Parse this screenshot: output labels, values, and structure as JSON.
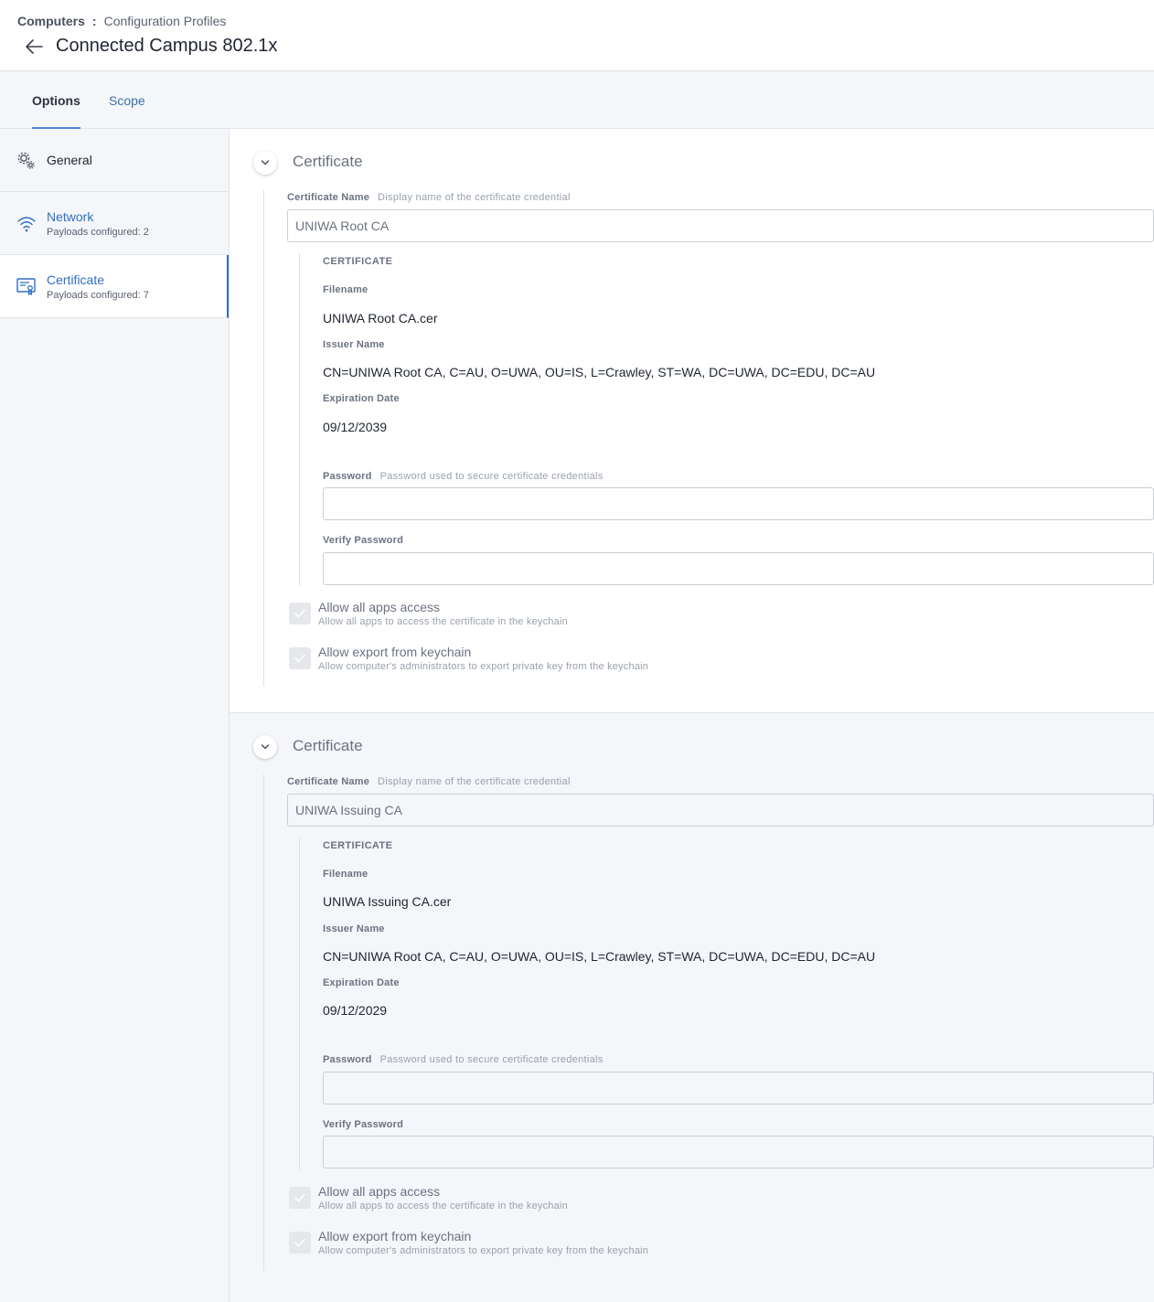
{
  "header": {
    "breadcrumb_root": "Computers",
    "breadcrumb_separator": ":",
    "breadcrumb_current": "Configuration Profiles",
    "title": "Connected Campus 802.1x"
  },
  "tabs": [
    {
      "label": "Options",
      "active": true
    },
    {
      "label": "Scope",
      "active": false
    }
  ],
  "sidebar": {
    "items": [
      {
        "label": "General",
        "sub": "",
        "icon": "gear-icon"
      },
      {
        "label": "Network",
        "sub": "Payloads configured: 2",
        "icon": "wifi-icon"
      },
      {
        "label": "Certificate",
        "sub": "Payloads configured: 7",
        "icon": "certificate-icon",
        "selected": true
      }
    ]
  },
  "certificates": [
    {
      "section_title": "Certificate",
      "name_label": "Certificate Name",
      "name_hint": "Display name of the certificate credential",
      "name_value": "UNIWA Root CA",
      "cert_heading": "CERTIFICATE",
      "filename_label": "Filename",
      "filename": "UNIWA Root CA.cer",
      "issuer_label": "Issuer Name",
      "issuer": "CN=UNIWA Root CA, C=AU, O=UWA, OU=IS, L=Crawley, ST=WA, DC=UWA, DC=EDU, DC=AU",
      "expiration_label": "Expiration Date",
      "expiration": "09/12/2039",
      "password_label": "Password",
      "password_hint": "Password used to secure certificate credentials",
      "verify_label": "Verify Password",
      "allow_all_label": "Allow all apps access",
      "allow_all_desc": "Allow all apps to access the certificate in the keychain",
      "allow_export_label": "Allow export from keychain",
      "allow_export_desc": "Allow computer's administrators to export private key from the keychain"
    },
    {
      "section_title": "Certificate",
      "name_label": "Certificate Name",
      "name_hint": "Display name of the certificate credential",
      "name_value": "UNIWA Issuing CA",
      "cert_heading": "CERTIFICATE",
      "filename_label": "Filename",
      "filename": "UNIWA Issuing CA.cer",
      "issuer_label": "Issuer Name",
      "issuer": "CN=UNIWA Root CA, C=AU, O=UWA, OU=IS, L=Crawley, ST=WA, DC=UWA, DC=EDU, DC=AU",
      "expiration_label": "Expiration Date",
      "expiration": "09/12/2029",
      "password_label": "Password",
      "password_hint": "Password used to secure certificate credentials",
      "verify_label": "Verify Password",
      "allow_all_label": "Allow all apps access",
      "allow_all_desc": "Allow all apps to access the certificate in the keychain",
      "allow_export_label": "Allow export from keychain",
      "allow_export_desc": "Allow computer's administrators to export private key from the keychain"
    }
  ],
  "colors": {
    "accent": "#2f6fc0",
    "tab_underline": "#4b88d6",
    "panel_background": "#f4f6f9"
  }
}
